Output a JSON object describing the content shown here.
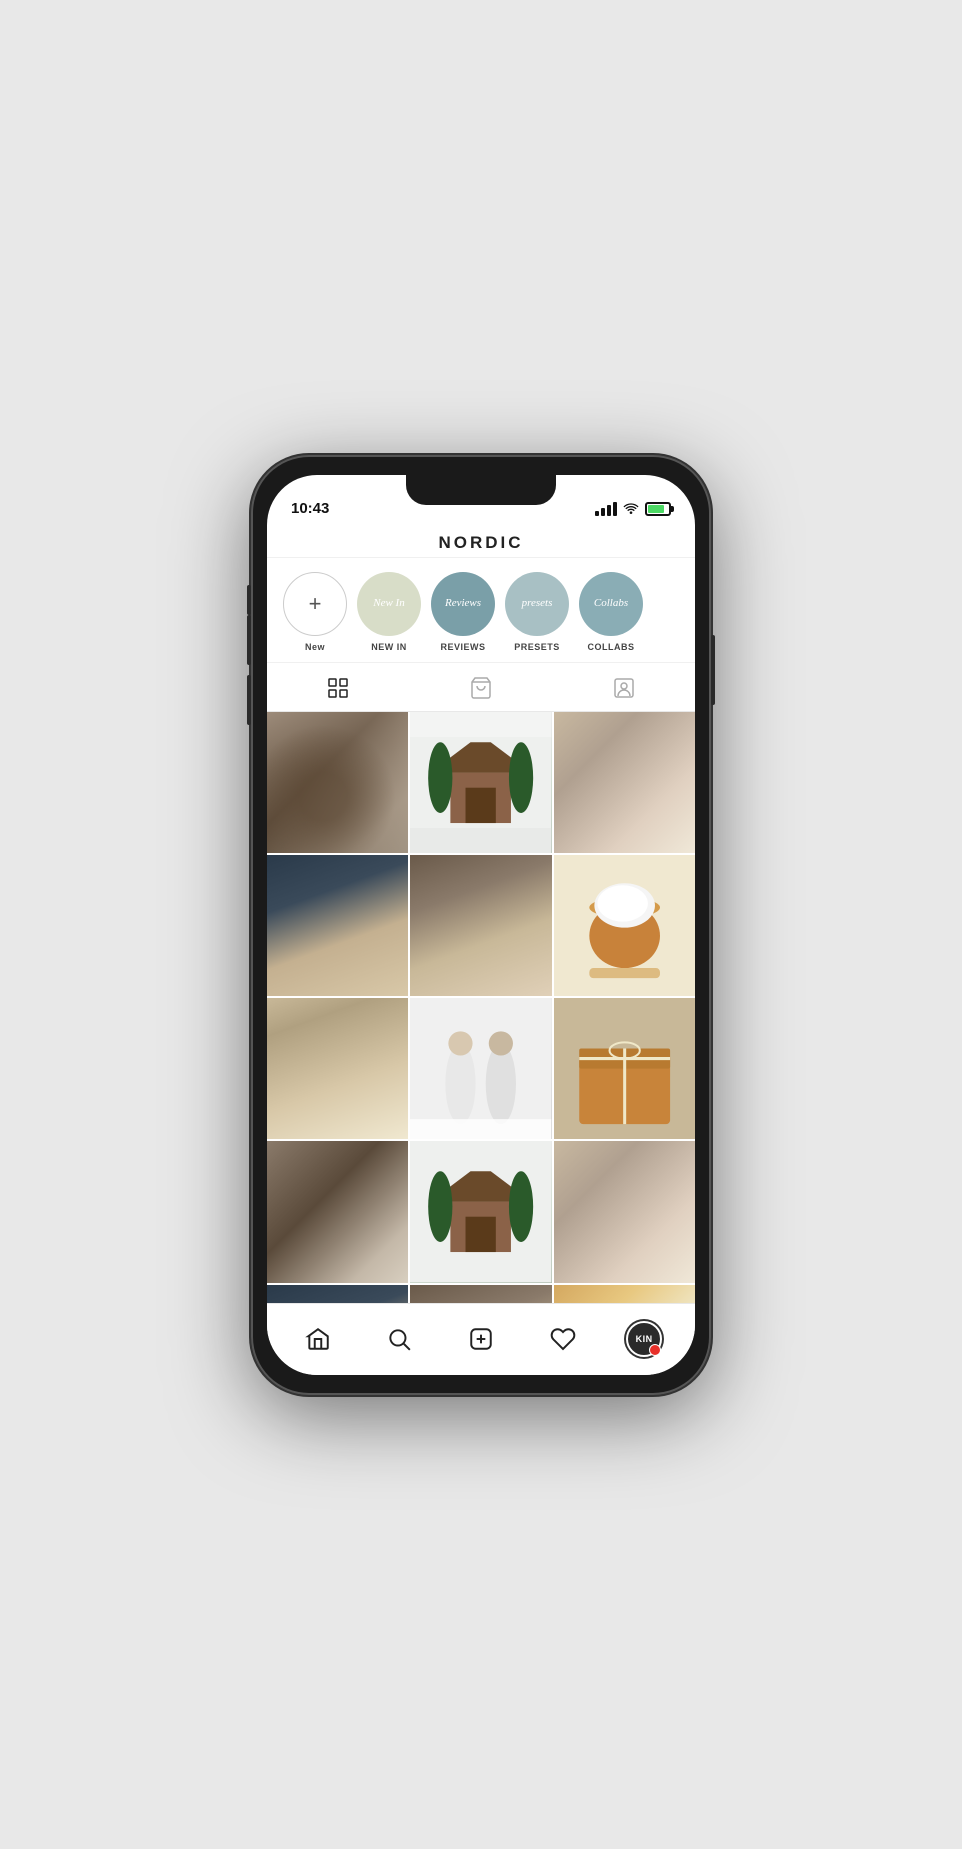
{
  "phone": {
    "time": "10:43"
  },
  "app": {
    "title": "NORDIC"
  },
  "stories": [
    {
      "id": "new",
      "label": "New",
      "type": "new",
      "color": "new-circle",
      "inner": ""
    },
    {
      "id": "new-in",
      "label": "NEW IN",
      "type": "circle",
      "color": "light-green",
      "inner": "New In"
    },
    {
      "id": "reviews",
      "label": "REVIEWS",
      "type": "circle",
      "color": "teal",
      "inner": "Reviews"
    },
    {
      "id": "presets",
      "label": "PRESETS",
      "type": "circle",
      "color": "light-teal",
      "inner": "presets"
    },
    {
      "id": "collabs",
      "label": "COLLABS",
      "type": "circle",
      "color": "medium-teal",
      "inner": "Collabs"
    }
  ],
  "tabs": {
    "grid_label": "Grid view",
    "shop_label": "Shop",
    "tag_label": "Tagged"
  },
  "photos": [
    {
      "id": 1,
      "class": "p1"
    },
    {
      "id": 2,
      "class": "p2"
    },
    {
      "id": 3,
      "class": "p3"
    },
    {
      "id": 4,
      "class": "p4"
    },
    {
      "id": 5,
      "class": "p5"
    },
    {
      "id": 6,
      "class": "p6"
    },
    {
      "id": 7,
      "class": "p7"
    },
    {
      "id": 8,
      "class": "p8"
    },
    {
      "id": 9,
      "class": "p9"
    },
    {
      "id": 10,
      "class": "p10"
    },
    {
      "id": 11,
      "class": "p11"
    },
    {
      "id": 12,
      "class": "p12"
    },
    {
      "id": 13,
      "class": "p13"
    },
    {
      "id": 14,
      "class": "p14"
    },
    {
      "id": 15,
      "class": "p15"
    }
  ],
  "nav": {
    "home_label": "Home",
    "search_label": "Search",
    "add_label": "Add",
    "likes_label": "Likes",
    "profile_label": "Profile",
    "profile_initials": "KIN"
  }
}
